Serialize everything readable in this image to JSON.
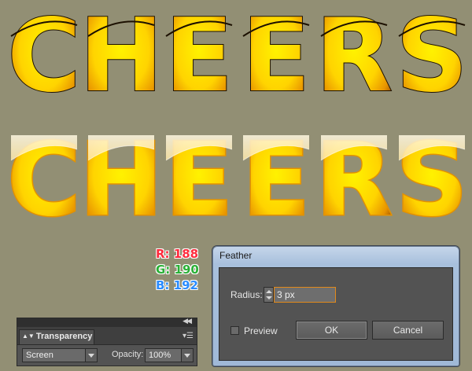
{
  "artwork": {
    "word": "CHEERS",
    "colors": {
      "face": "#ffe600",
      "rim": "#e39200",
      "edge": "#a85a00",
      "outline": "#1c1000",
      "glaze": "#fff3c8"
    }
  },
  "rgb_readout": {
    "r": "R: 188",
    "g": "G: 190",
    "b": "B: 192"
  },
  "feather_dialog": {
    "title": "Feather",
    "radius_label": "Radius:",
    "radius_value": "3 px",
    "preview_label": "Preview",
    "ok_label": "OK",
    "cancel_label": "Cancel"
  },
  "transparency_panel": {
    "tab_label": "Transparency",
    "blend_mode": "Screen",
    "opacity_label": "Opacity:",
    "opacity_value": "100%"
  }
}
